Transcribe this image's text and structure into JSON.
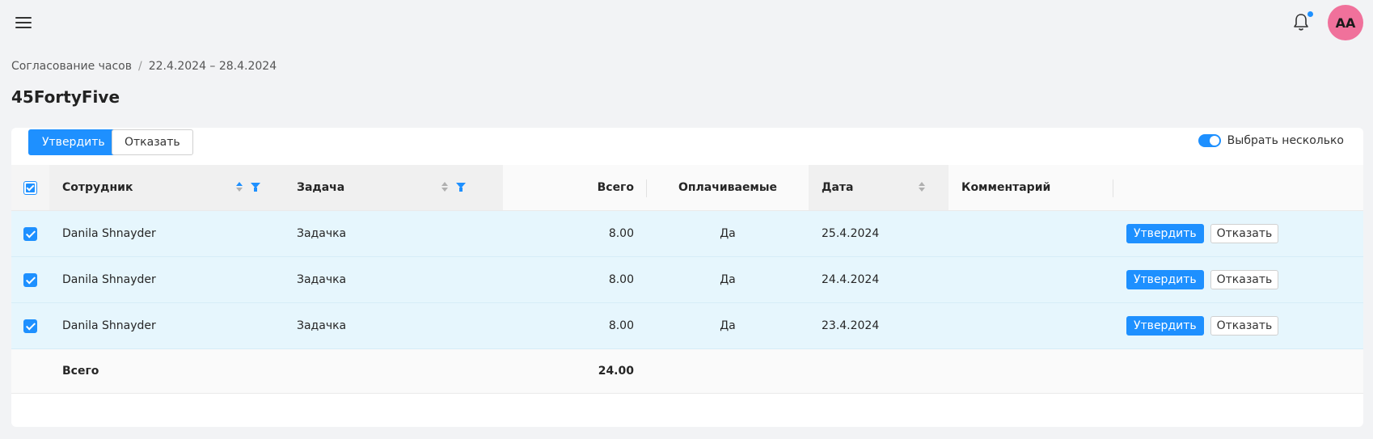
{
  "header": {
    "avatar_initials": "AA"
  },
  "breadcrumb": {
    "parent": "Согласование часов",
    "separator": "/",
    "current": "22.4.2024 – 28.4.2024"
  },
  "page_title": "45FortyFive",
  "toolbar": {
    "approve_label": "Утвердить",
    "reject_label": "Отказать",
    "multi_select_label": "Выбрать несколько",
    "multi_select_on": true
  },
  "table": {
    "columns": {
      "employee": "Сотрудник",
      "task": "Задача",
      "total": "Всего",
      "billable": "Оплачиваемые",
      "date": "Дата",
      "comment": "Комментарий"
    },
    "rows": [
      {
        "employee": "Danila Shnayder",
        "task": "Задачка",
        "total": "8.00",
        "billable": "Да",
        "date": "25.4.2024",
        "comment": "",
        "approve": "Утвердить",
        "reject": "Отказать"
      },
      {
        "employee": "Danila Shnayder",
        "task": "Задачка",
        "total": "8.00",
        "billable": "Да",
        "date": "24.4.2024",
        "comment": "",
        "approve": "Утвердить",
        "reject": "Отказать"
      },
      {
        "employee": "Danila Shnayder",
        "task": "Задачка",
        "total": "8.00",
        "billable": "Да",
        "date": "23.4.2024",
        "comment": "",
        "approve": "Утвердить",
        "reject": "Отказать"
      }
    ],
    "footer": {
      "label": "Всего",
      "total": "24.00"
    }
  },
  "colors": {
    "primary": "#1e90ff",
    "avatar": "#f0719b",
    "selected_row": "#e6f6fd"
  }
}
